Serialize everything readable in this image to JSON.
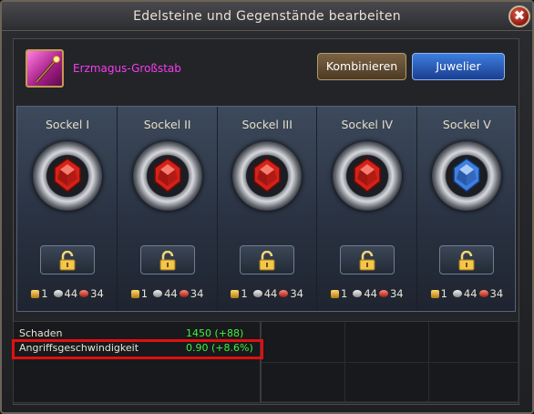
{
  "window": {
    "title": "Edelsteine und Gegenstände bearbeiten",
    "close": "✖"
  },
  "item": {
    "name": "Erzmagus-Großstab",
    "icon": "staff-icon"
  },
  "buttons": {
    "kombinieren": "Kombinieren",
    "juwelier": "Juwelier"
  },
  "sockets": [
    {
      "label": "Sockel I",
      "gem": "red",
      "coins": "1",
      "ore": "44",
      "ruby": "34"
    },
    {
      "label": "Sockel II",
      "gem": "red",
      "coins": "1",
      "ore": "44",
      "ruby": "34"
    },
    {
      "label": "Sockel III",
      "gem": "red",
      "coins": "1",
      "ore": "44",
      "ruby": "34"
    },
    {
      "label": "Sockel IV",
      "gem": "red",
      "coins": "1",
      "ore": "44",
      "ruby": "34"
    },
    {
      "label": "Sockel V",
      "gem": "blue",
      "coins": "1",
      "ore": "44",
      "ruby": "34"
    }
  ],
  "stats": [
    {
      "name": "Schaden",
      "value": "1450  (+88)"
    },
    {
      "name": "Angriffsgeschwindigkeit",
      "value": "0.90  (+8.6%)",
      "highlighted": true
    }
  ],
  "colors": {
    "gem_red": "#d4221a",
    "gem_blue": "#3f7fe0",
    "highlight": "#e01010",
    "stat_value": "#3ef03e"
  }
}
